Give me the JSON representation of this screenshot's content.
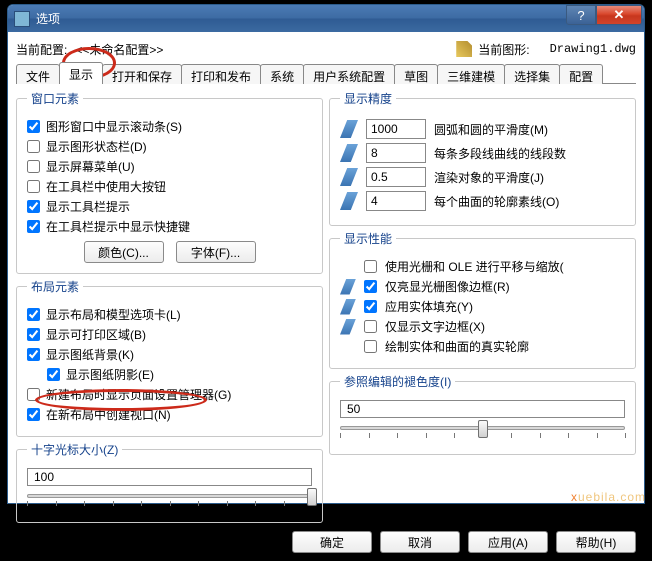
{
  "window": {
    "title": "选项"
  },
  "config": {
    "current_label": "当前配置:",
    "current_value": "<<未命名配置>>",
    "drawing_label": "当前图形:",
    "drawing_value": "Drawing1.dwg"
  },
  "tabs": [
    "文件",
    "显示",
    "打开和保存",
    "打印和发布",
    "系统",
    "用户系统配置",
    "草图",
    "三维建模",
    "选择集",
    "配置"
  ],
  "window_elements": {
    "legend": "窗口元素",
    "items": [
      {
        "label": "图形窗口中显示滚动条(S)",
        "checked": true
      },
      {
        "label": "显示图形状态栏(D)",
        "checked": false
      },
      {
        "label": "显示屏幕菜单(U)",
        "checked": false
      },
      {
        "label": "在工具栏中使用大按钮",
        "checked": false
      },
      {
        "label": "显示工具栏提示",
        "checked": true
      },
      {
        "label": "在工具栏提示中显示快捷键",
        "checked": true
      }
    ],
    "color_btn": "颜色(C)...",
    "font_btn": "字体(F)..."
  },
  "layout_elements": {
    "legend": "布局元素",
    "items": [
      {
        "label": "显示布局和模型选项卡(L)",
        "checked": true,
        "indent": false
      },
      {
        "label": "显示可打印区域(B)",
        "checked": true,
        "indent": false
      },
      {
        "label": "显示图纸背景(K)",
        "checked": true,
        "indent": false
      },
      {
        "label": "显示图纸阴影(E)",
        "checked": true,
        "indent": true
      },
      {
        "label": "新建布局时显示页面设置管理器(G)",
        "checked": false,
        "indent": false
      },
      {
        "label": "在新布局中创建视口(N)",
        "checked": true,
        "indent": false
      }
    ]
  },
  "crosshair": {
    "legend": "十字光标大小(Z)",
    "value": "100",
    "pos": 100
  },
  "precision": {
    "legend": "显示精度",
    "rows": [
      {
        "value": "1000",
        "label": "圆弧和圆的平滑度(M)"
      },
      {
        "value": "8",
        "label": "每条多段线曲线的线段数"
      },
      {
        "value": "0.5",
        "label": "渲染对象的平滑度(J)"
      },
      {
        "value": "4",
        "label": "每个曲面的轮廓素线(O)"
      }
    ]
  },
  "performance": {
    "legend": "显示性能",
    "items": [
      {
        "label": "使用光栅和 OLE 进行平移与缩放(",
        "checked": false,
        "icon": false
      },
      {
        "label": "仅亮显光栅图像边框(R)",
        "checked": true,
        "icon": true
      },
      {
        "label": "应用实体填充(Y)",
        "checked": true,
        "icon": true
      },
      {
        "label": "仅显示文字边框(X)",
        "checked": false,
        "icon": true
      },
      {
        "label": "绘制实体和曲面的真实轮廓",
        "checked": false,
        "icon": false
      }
    ]
  },
  "fade": {
    "legend": "参照编辑的褪色度(I)",
    "value": "50",
    "pos": 50
  },
  "buttons": {
    "ok": "确定",
    "cancel": "取消",
    "apply": "应用(A)",
    "help": "帮助(H)"
  },
  "watermark": "uebila.com"
}
